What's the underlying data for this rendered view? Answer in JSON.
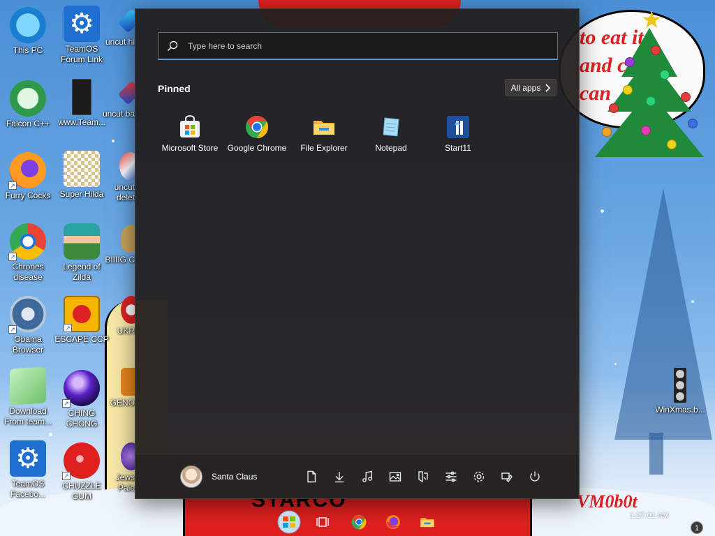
{
  "desktop": {
    "icons": [
      {
        "label": "This PC",
        "icon": "monitor-icon"
      },
      {
        "label": "TeamOS Forum Link",
        "icon": "gear-icon"
      },
      {
        "label": "uncut hi",
        "icon": "gem-icon"
      },
      {
        "label": "Falcon C++",
        "icon": "recycle-icon"
      },
      {
        "label": "www.Team...",
        "icon": "document-icon"
      },
      {
        "label": "uncut ba",
        "icon": "gem-icon"
      },
      {
        "label": "Furry Cocks",
        "icon": "firefox-icon"
      },
      {
        "label": "Super Hilda",
        "icon": "pixel-dog-icon"
      },
      {
        "label": "uncut delet",
        "icon": "gem-icon"
      },
      {
        "label": "Chrones disease",
        "icon": "chrome-icon"
      },
      {
        "label": "Legend of Zilda",
        "icon": "pixel-hero-icon"
      },
      {
        "label": "BIIIIG C",
        "icon": "money-bag-icon"
      },
      {
        "label": "Obama Browser",
        "icon": "gear-icon"
      },
      {
        "label": "ESCAPE CCP",
        "icon": "mahjong-icon"
      },
      {
        "label": "UKR",
        "icon": "red-circle-icon"
      },
      {
        "label": "Download From team...",
        "icon": "notepad-icon"
      },
      {
        "label": "CHING CHONG",
        "icon": "bomb-icon"
      },
      {
        "label": "GENO",
        "icon": "puzzle-icon"
      },
      {
        "label": "TeamOS Facebo...",
        "icon": "gear-icon"
      },
      {
        "label": "CHUZZLE GUM",
        "icon": "chuzzle-icon"
      },
      {
        "label": "Jews Pale",
        "icon": "purple-orb-icon"
      },
      {
        "label": "WinXmas.b...",
        "icon": "ornament-strip-icon"
      }
    ],
    "speech_text": [
      "to eat it",
      "and c",
      "can"
    ],
    "banner_text": "STARCO",
    "watermark": "VM0b0t"
  },
  "start_menu": {
    "search_placeholder": "Type here to search",
    "pinned_title": "Pinned",
    "all_apps_label": "All apps",
    "pinned_apps": [
      {
        "label": "Microsoft Store",
        "icon": "store-icon"
      },
      {
        "label": "Google Chrome",
        "icon": "chrome-icon"
      },
      {
        "label": "File Explorer",
        "icon": "folder-icon"
      },
      {
        "label": "Notepad",
        "icon": "notepad-icon"
      },
      {
        "label": "Start11",
        "icon": "start11-icon"
      }
    ],
    "user_name": "Santa Claus",
    "footer_icons": [
      "documents-icon",
      "downloads-icon",
      "music-icon",
      "pictures-icon",
      "network-icon",
      "settings-sliders-icon",
      "gear-icon",
      "personalize-icon",
      "power-icon"
    ]
  },
  "taskbar": {
    "clock": "1:27:01 AM",
    "notification_count": "1",
    "buttons": [
      "start-orb-icon",
      "task-view-icon",
      "chrome-icon",
      "firefox-icon",
      "file-explorer-icon"
    ]
  },
  "colors": {
    "menu_bg": "#221e1e",
    "accent": "#5b9be0",
    "desktop_sky": "#4a8fd6",
    "santa_red": "#e0201f"
  }
}
